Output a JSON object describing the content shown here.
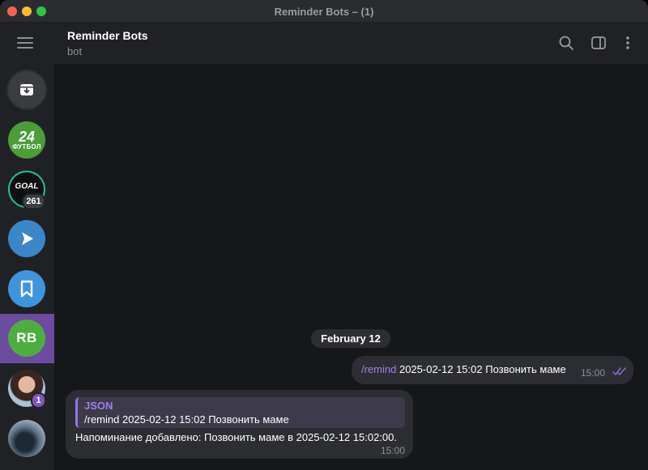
{
  "window": {
    "title": "Reminder Bots – (1)"
  },
  "sidebar": {
    "chats": [
      {
        "name": "archive",
        "icon": "archive-icon"
      },
      {
        "name": "24 futbol",
        "line1": "24",
        "line2": "ФУТБОЛ"
      },
      {
        "name": "goal",
        "label": "GOAL",
        "badge": "261"
      },
      {
        "name": "arrow-channel",
        "icon": "play-arrow-icon"
      },
      {
        "name": "saved-messages",
        "icon": "bookmark-icon"
      },
      {
        "name": "reminder-bots",
        "initials": "RB",
        "selected": true
      },
      {
        "name": "person",
        "badge": "1"
      },
      {
        "name": "landscape"
      }
    ],
    "colors": {
      "selected": "#6c4ba0",
      "unread_badge": "#7e57c2"
    }
  },
  "header": {
    "name": "Reminder Bots",
    "status": "bot"
  },
  "chat": {
    "date": "February 12",
    "outgoing": {
      "command": "/remind",
      "text": " 2025-02-12 15:02 Позвонить маме",
      "time": "15:00",
      "status": "read"
    },
    "incoming": {
      "reply_author": "JSON",
      "reply_text": "/remind 2025-02-12 15:02 Позвонить маме",
      "text": "Напоминание добавлено: Позвонить маме в 2025-02-12 15:02:00.",
      "time": "15:00"
    }
  }
}
